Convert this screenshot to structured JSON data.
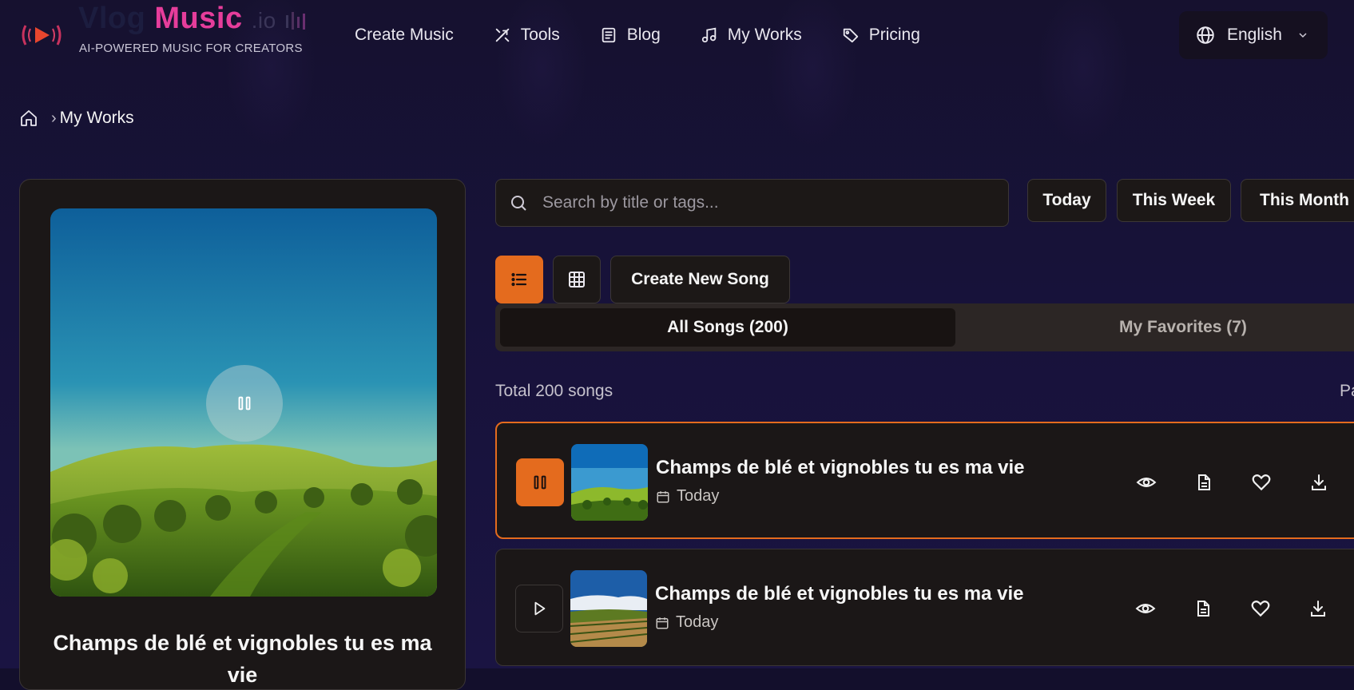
{
  "brand": {
    "name_part1": "Vlog",
    "name_part2": "Music",
    "name_part3": ".io",
    "tagline": "AI-POWERED MUSIC FOR CREATORS",
    "accent": "#e63d9b"
  },
  "nav": {
    "items": [
      {
        "label": "Create Music",
        "icon": "none"
      },
      {
        "label": "Tools",
        "icon": "tools-icon"
      },
      {
        "label": "Blog",
        "icon": "document-icon"
      },
      {
        "label": "My Works",
        "icon": "music-note-icon"
      },
      {
        "label": "Pricing",
        "icon": "tag-icon"
      }
    ],
    "language": "English"
  },
  "breadcrumb": {
    "current": "My Works"
  },
  "player": {
    "title": "Champs de blé et vignobles tu es ma vie",
    "state": "playing"
  },
  "search": {
    "placeholder": "Search by title or tags..."
  },
  "filters": [
    "Today",
    "This Week",
    "This Month"
  ],
  "toolbar": {
    "create_label": "Create New Song"
  },
  "tabs": {
    "all": "All Songs (200)",
    "favorites": "My Favorites (7)"
  },
  "summary": {
    "total": "Total 200 songs",
    "page_partial": "Pa"
  },
  "songs": [
    {
      "title": "Champs de blé et vignobles tu es ma vie",
      "date": "Today",
      "playing": true
    },
    {
      "title": "Champs de blé et vignobles tu es ma vie",
      "date": "Today",
      "playing": false
    }
  ],
  "colors": {
    "accent_orange": "#e46b1e",
    "background": "#130f2c",
    "card": "#1b1717"
  }
}
